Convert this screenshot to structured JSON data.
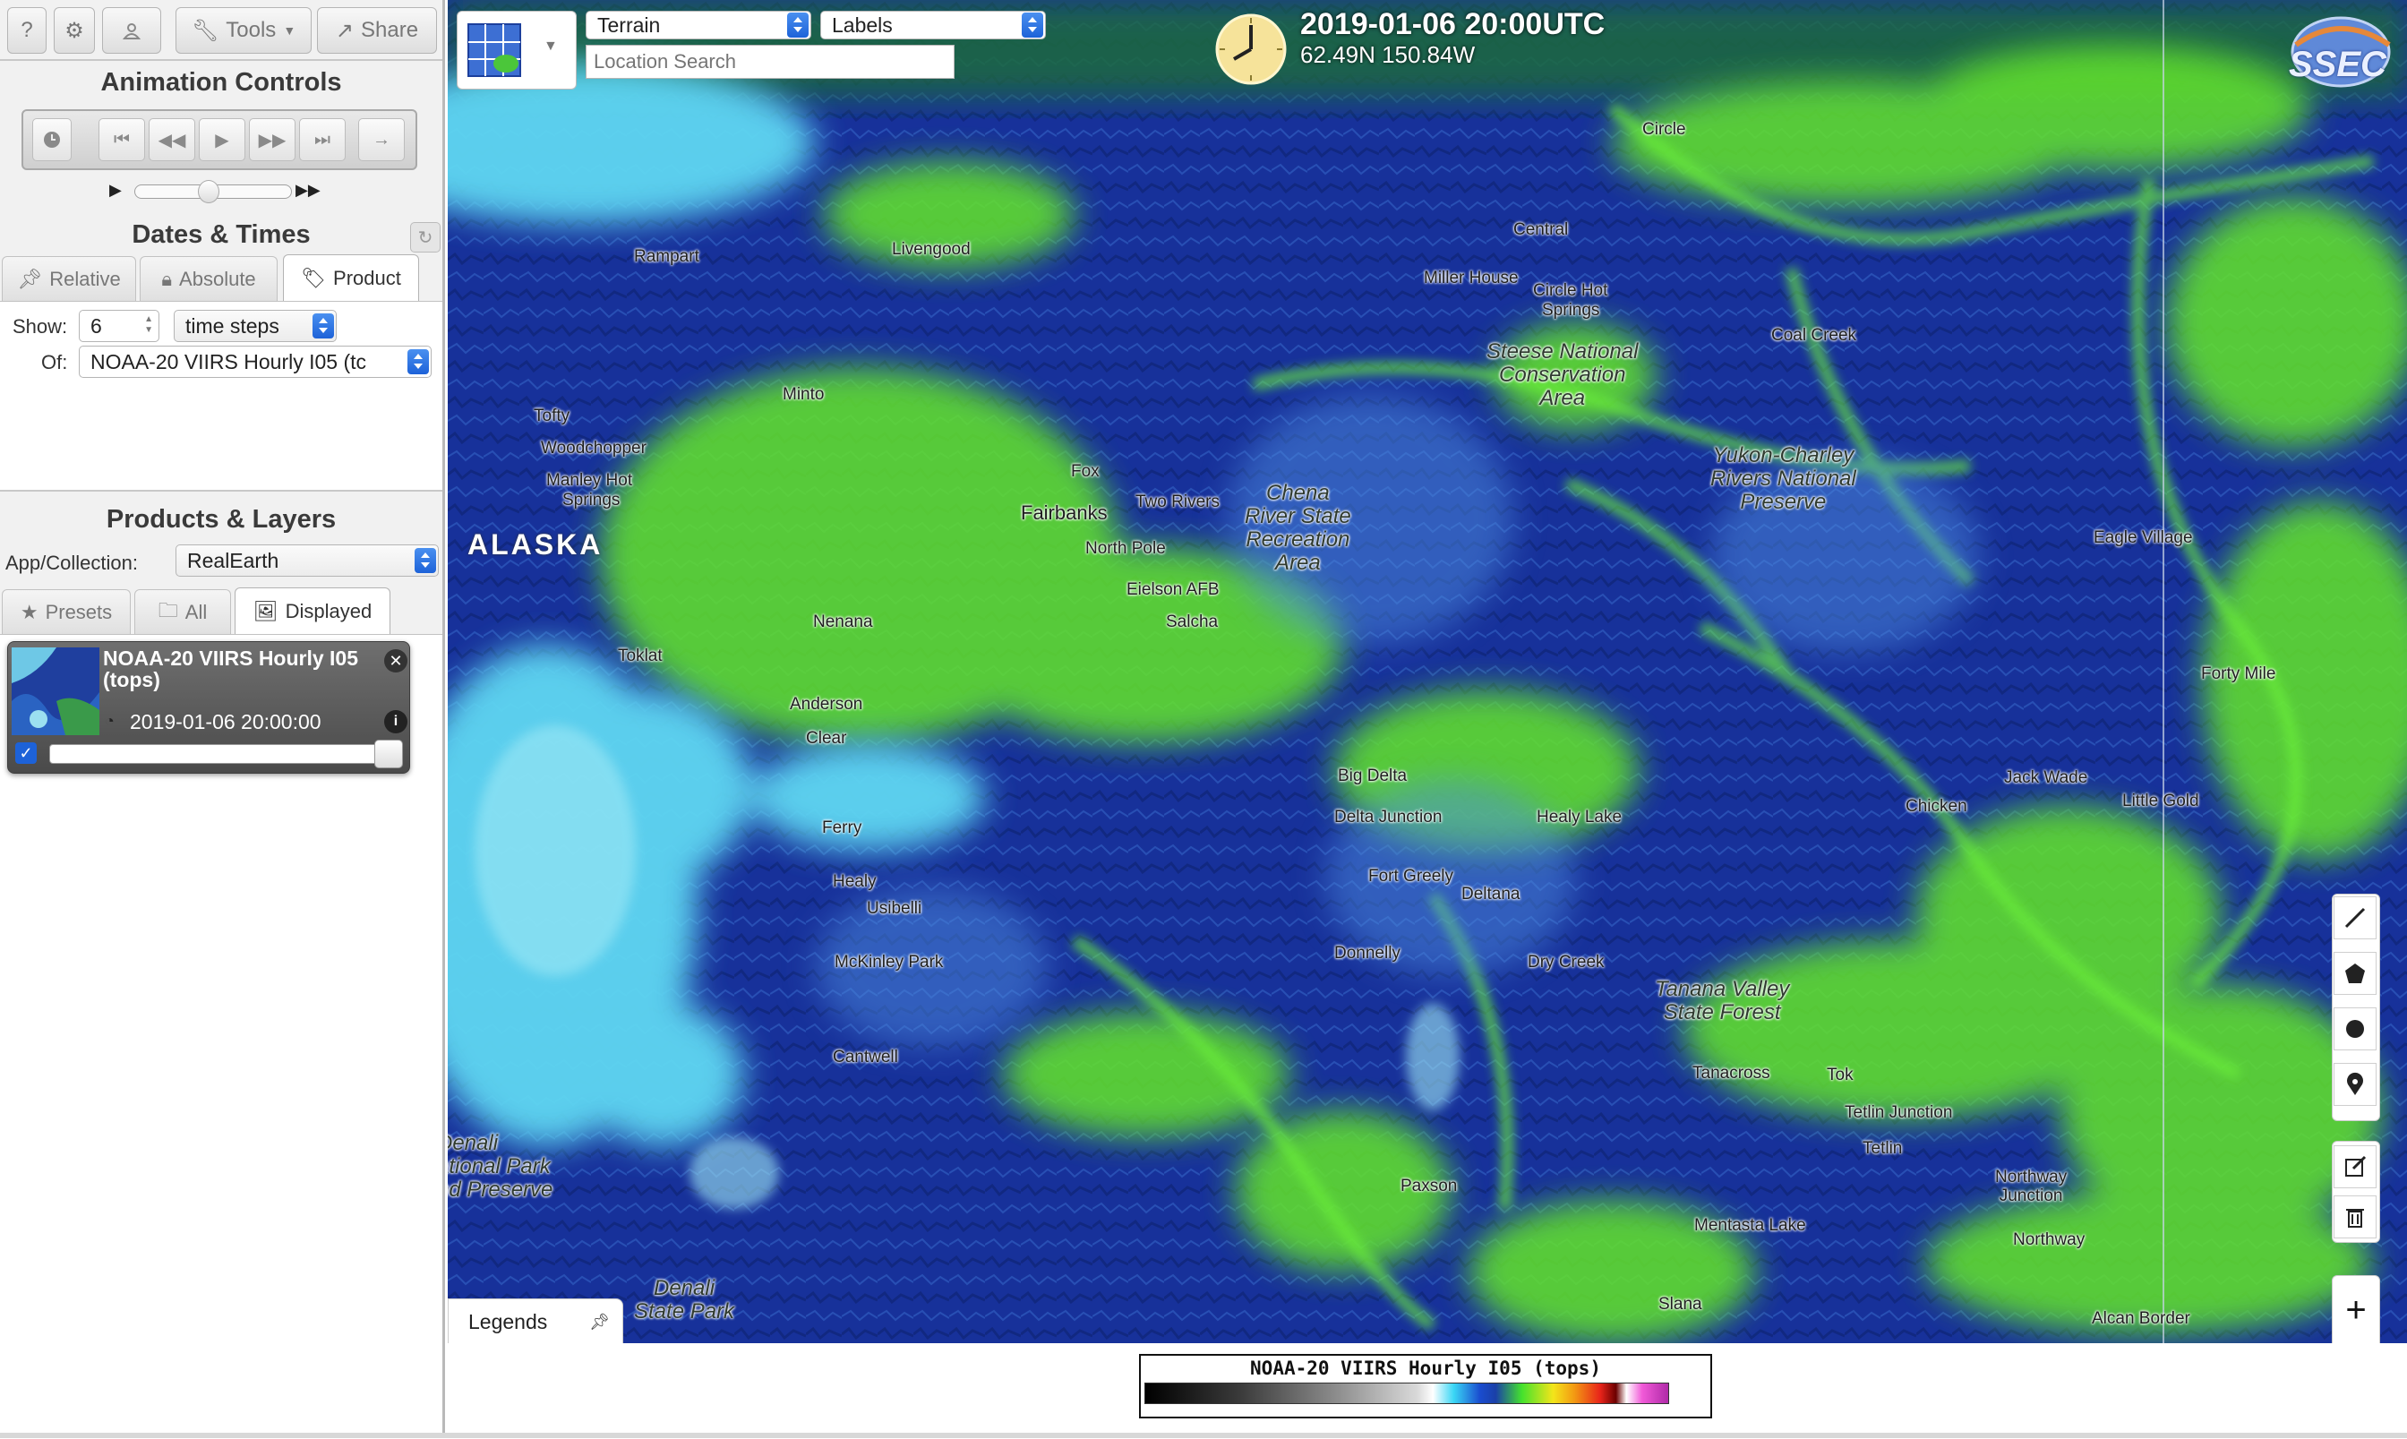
{
  "toolbar": {
    "help_label": "?",
    "tools_label": "Tools",
    "share_label": "Share"
  },
  "animation": {
    "title": "Animation Controls"
  },
  "dates": {
    "title": "Dates & Times",
    "tabs": [
      {
        "label": "Relative"
      },
      {
        "label": "Absolute"
      },
      {
        "label": "Product"
      }
    ],
    "active_tab": "Product",
    "show_label": "Show:",
    "show_value": "6",
    "steps_value": "time steps",
    "of_label": "Of:",
    "of_value": "NOAA-20 VIIRS Hourly I05 (tc"
  },
  "products": {
    "title": "Products & Layers",
    "collection_label": "App/Collection:",
    "collection_value": "RealEarth",
    "tabs": [
      {
        "label": "Presets"
      },
      {
        "label": "All"
      },
      {
        "label": "Displayed"
      }
    ],
    "active_tab": "Displayed",
    "layer": {
      "name": "NOAA-20 VIIRS Hourly I05 (tops)",
      "time": "2019-01-06 20:00:00",
      "checked": true,
      "opacity": 1.0
    }
  },
  "map_controls": {
    "basemap_value": "Terrain",
    "labels_value": "Labels",
    "search_placeholder": "Location Search"
  },
  "header": {
    "datetime": "2019-01-06 20:00UTC",
    "coords": "62.49N 150.84W",
    "logo": "SSEC"
  },
  "places": {
    "alaska": "ALASKA",
    "circle": "Circle",
    "central": "Central",
    "livengood": "Livengood",
    "rampart": "Rampart",
    "miller_house": "Miller House",
    "circle_hot_springs_1": "Circle Hot",
    "circle_hot_springs_2": "Springs",
    "coal_creek": "Coal Creek",
    "steese": "Steese National\nConservation\nArea",
    "minto": "Minto",
    "tofty": "Tofty",
    "woodchopper": "Woodchopper",
    "manley_1": "Manley Hot",
    "manley_2": "Springs",
    "yukon": "Yukon-Charley\nRivers National\nPreserve",
    "fox": "Fox",
    "fairbanks": "Fairbanks",
    "two_rivers": "Two Rivers",
    "chena": "Chena\nRiver State\nRecreation\nArea",
    "north_pole": "North Pole",
    "eagle_village": "Eagle Village",
    "eielson": "Eielson AFB",
    "salcha": "Salcha",
    "nenana": "Nenana",
    "toklat": "Toklat",
    "forty_mile": "Forty Mile",
    "anderson": "Anderson",
    "clear": "Clear",
    "big_delta": "Big Delta",
    "delta_junction": "Delta Junction",
    "healy_lake": "Healy Lake",
    "jack_wade": "Jack Wade",
    "chicken": "Chicken",
    "little_gold": "Little Gold",
    "ferry": "Ferry",
    "healy": "Healy",
    "usibelli": "Usibelli",
    "fort_greely": "Fort Greely",
    "deltana": "Deltana",
    "donnelly": "Donnelly",
    "dry_creek": "Dry Creek",
    "mckinley_park": "McKinley Park",
    "tanana_valley": "Tanana Valley\nState Forest",
    "cantwell": "Cantwell",
    "tanacross": "Tanacross",
    "tok": "Tok",
    "tetlin_junction": "Tetlin Junction",
    "tetlin": "Tetlin",
    "denali_np": "Denali\national Park\nnd Preserve",
    "paxson": "Paxson",
    "northway_junction": "Northway\nJunction",
    "mentasta_lake": "Mentasta Lake",
    "northway": "Northway",
    "denali_sp": "Denali\nState Park",
    "slana": "Slana",
    "alcan_border": "Alcan Border"
  },
  "legends": {
    "tab_label": "Legends",
    "title": "NOAA-20 VIIRS Hourly I05 (tops)"
  },
  "colors": {
    "accent_blue": "#1d62d8",
    "map_green": "#5ee82a",
    "map_blue": "#14309a",
    "cloud_cyan": "#5ad8f0"
  }
}
